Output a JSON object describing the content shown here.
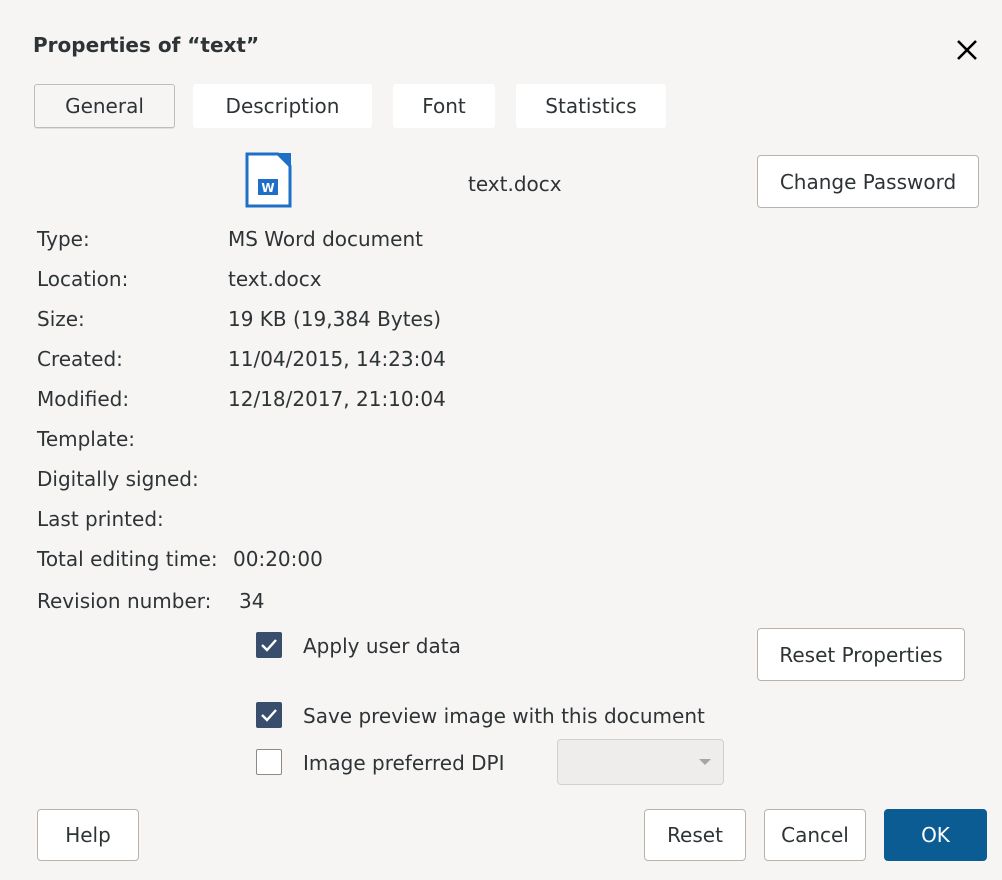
{
  "dialog": {
    "title": "Properties of “text”",
    "close_icon": "close-icon"
  },
  "tabs": [
    {
      "label": "General",
      "active": true
    },
    {
      "label": "Description",
      "active": false
    },
    {
      "label": "Font",
      "active": false
    },
    {
      "label": "Statistics",
      "active": false
    }
  ],
  "file": {
    "icon": "word-document-icon",
    "name": "text.docx",
    "change_password_label": "Change Password"
  },
  "properties": [
    {
      "label": "Type:",
      "value": "MS Word document"
    },
    {
      "label": "Location:",
      "value": "text.docx"
    },
    {
      "label": "Size:",
      "value": "19 KB (19,384 Bytes)"
    },
    {
      "label": "Created:",
      "value": "11/04/2015, 14:23:04"
    },
    {
      "label": "Modified:",
      "value": "12/18/2017, 21:10:04"
    },
    {
      "label": "Template:",
      "value": ""
    },
    {
      "label": "Digitally signed:",
      "value": ""
    },
    {
      "label": "Last printed:",
      "value": ""
    },
    {
      "label": "Total editing time:",
      "value": "00:20:00"
    },
    {
      "label": "Revision number:",
      "value": "34"
    }
  ],
  "options": {
    "apply_user_data": {
      "label": "Apply user data",
      "checked": true
    },
    "save_preview": {
      "label": "Save preview image with this document",
      "checked": true
    },
    "image_dpi": {
      "label": "Image preferred DPI",
      "checked": false,
      "value": ""
    },
    "reset_properties_label": "Reset Properties"
  },
  "footer": {
    "help_label": "Help",
    "reset_label": "Reset",
    "cancel_label": "Cancel",
    "ok_label": "OK"
  },
  "colors": {
    "accent": "#0b5c93",
    "checkbox": "#394e6c",
    "background": "#f6f5f4"
  }
}
